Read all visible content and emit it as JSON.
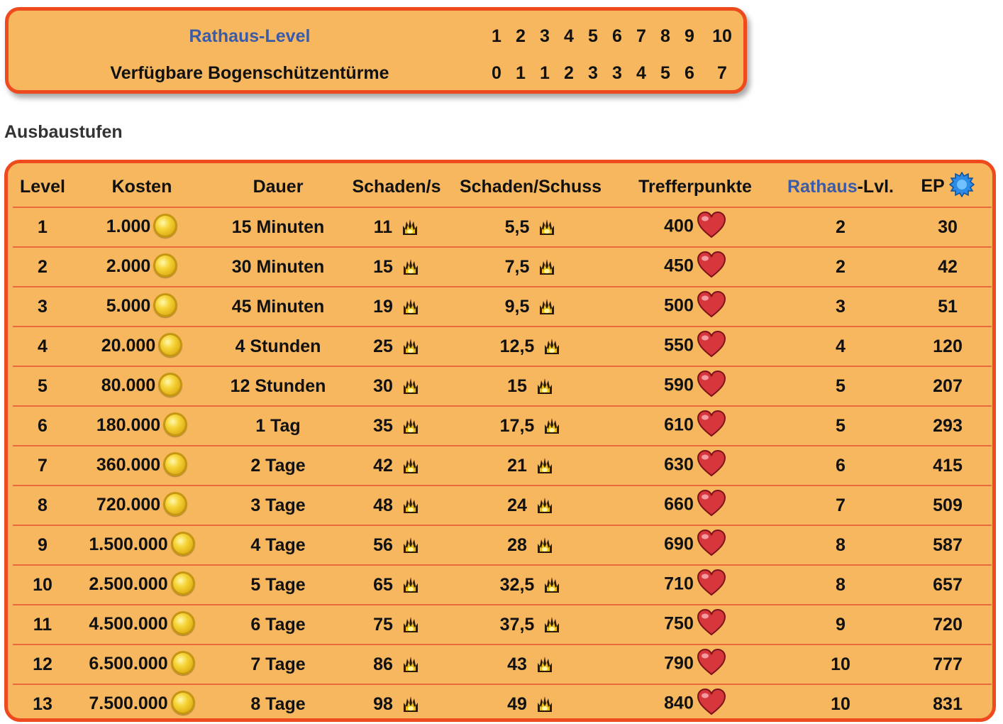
{
  "townhall": {
    "label_level": "Rathaus-Level",
    "label_towers": "Verfügbare Bogenschützentürme",
    "levels": [
      "1",
      "2",
      "3",
      "4",
      "5",
      "6",
      "7",
      "8",
      "9",
      "10"
    ],
    "towers": [
      "0",
      "1",
      "1",
      "2",
      "3",
      "3",
      "4",
      "5",
      "6",
      "7"
    ]
  },
  "section_title": "Ausbaustufen",
  "table": {
    "headers": {
      "level": "Level",
      "cost": "Kosten",
      "duration": "Dauer",
      "dps": "Schaden/s",
      "dmg_shot": "Schaden/Schuss",
      "hp": "Trefferpunkte",
      "th_level_highlight": "Rathaus",
      "th_level_rest": "-Lvl.",
      "xp": "EP"
    },
    "icons": {
      "cost": "gold-coin-icon",
      "dps": "fire-icon",
      "hp": "heart-icon",
      "xp": "experience-gear-icon"
    },
    "colors": {
      "background": "#f6b75f",
      "border": "#ee4a1e",
      "highlight": "#3a5ca8"
    },
    "rows": [
      {
        "level": "1",
        "cost": "1.000",
        "duration": "15 Minuten",
        "dps": "11",
        "dmg": "5,5",
        "hp": "400",
        "th": "2",
        "xp": "30"
      },
      {
        "level": "2",
        "cost": "2.000",
        "duration": "30 Minuten",
        "dps": "15",
        "dmg": "7,5",
        "hp": "450",
        "th": "2",
        "xp": "42"
      },
      {
        "level": "3",
        "cost": "5.000",
        "duration": "45 Minuten",
        "dps": "19",
        "dmg": "9,5",
        "hp": "500",
        "th": "3",
        "xp": "51"
      },
      {
        "level": "4",
        "cost": "20.000",
        "duration": "4 Stunden",
        "dps": "25",
        "dmg": "12,5",
        "hp": "550",
        "th": "4",
        "xp": "120"
      },
      {
        "level": "5",
        "cost": "80.000",
        "duration": "12 Stunden",
        "dps": "30",
        "dmg": "15",
        "hp": "590",
        "th": "5",
        "xp": "207"
      },
      {
        "level": "6",
        "cost": "180.000",
        "duration": "1 Tag",
        "dps": "35",
        "dmg": "17,5",
        "hp": "610",
        "th": "5",
        "xp": "293"
      },
      {
        "level": "7",
        "cost": "360.000",
        "duration": "2 Tage",
        "dps": "42",
        "dmg": "21",
        "hp": "630",
        "th": "6",
        "xp": "415"
      },
      {
        "level": "8",
        "cost": "720.000",
        "duration": "3 Tage",
        "dps": "48",
        "dmg": "24",
        "hp": "660",
        "th": "7",
        "xp": "509"
      },
      {
        "level": "9",
        "cost": "1.500.000",
        "duration": "4 Tage",
        "dps": "56",
        "dmg": "28",
        "hp": "690",
        "th": "8",
        "xp": "587"
      },
      {
        "level": "10",
        "cost": "2.500.000",
        "duration": "5 Tage",
        "dps": "65",
        "dmg": "32,5",
        "hp": "710",
        "th": "8",
        "xp": "657"
      },
      {
        "level": "11",
        "cost": "4.500.000",
        "duration": "6 Tage",
        "dps": "75",
        "dmg": "37,5",
        "hp": "750",
        "th": "9",
        "xp": "720"
      },
      {
        "level": "12",
        "cost": "6.500.000",
        "duration": "7 Tage",
        "dps": "86",
        "dmg": "43",
        "hp": "790",
        "th": "10",
        "xp": "777"
      },
      {
        "level": "13",
        "cost": "7.500.000",
        "duration": "8 Tage",
        "dps": "98",
        "dmg": "49",
        "hp": "840",
        "th": "10",
        "xp": "831"
      }
    ]
  }
}
